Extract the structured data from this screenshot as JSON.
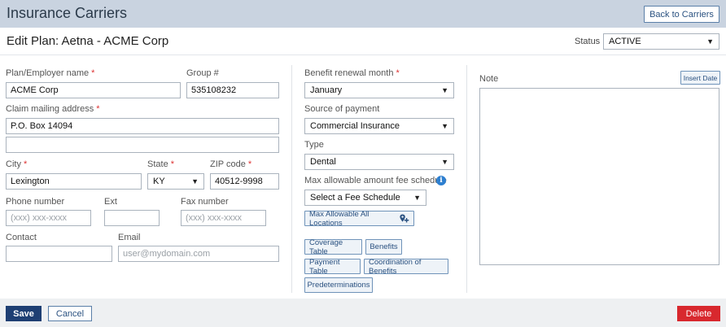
{
  "header": {
    "title": "Insurance Carriers",
    "back_button": "Back to Carriers"
  },
  "subheader": {
    "title": "Edit Plan: Aetna - ACME Corp",
    "status_label": "Status",
    "status_value": "ACTIVE"
  },
  "form": {
    "plan_name_label": "Plan/Employer name",
    "plan_name_value": "ACME Corp",
    "group_label": "Group #",
    "group_value": "535108232",
    "claim_address_label": "Claim mailing address",
    "claim_address_line1": "P.O. Box 14094",
    "claim_address_line2": "",
    "city_label": "City",
    "city_value": "Lexington",
    "state_label": "State",
    "state_value": "KY",
    "zip_label": "ZIP code",
    "zip_value": "40512-9998",
    "phone_label": "Phone number",
    "phone_placeholder": "(xxx) xxx-xxxx",
    "ext_label": "Ext",
    "fax_label": "Fax number",
    "fax_placeholder": "(xxx) xxx-xxxx",
    "contact_label": "Contact",
    "email_label": "Email",
    "email_placeholder": "user@mydomain.com",
    "required_marker": "*"
  },
  "benefits": {
    "renewal_label": "Benefit renewal month",
    "renewal_value": "January",
    "payment_source_label": "Source of payment",
    "payment_source_value": "Commercial Insurance",
    "type_label": "Type",
    "type_value": "Dental",
    "fee_schedule_label": "Max allowable amount fee schedule",
    "fee_schedule_value": "Select a Fee Schedule",
    "max_allowable_button": "Max Allowable All Locations",
    "buttons": {
      "coverage_table": "Coverage Table",
      "benefits": "Benefits",
      "payment_table": "Payment Table",
      "coordination": "Coordination of Benefits",
      "predeterminations": "Predeterminations"
    }
  },
  "note": {
    "label": "Note",
    "insert_date": "Insert Date"
  },
  "footer": {
    "save": "Save",
    "cancel": "Cancel",
    "delete": "Delete"
  },
  "icons": {
    "chevron": "chevron-down-icon",
    "info": "info-icon",
    "location_add": "location-pin-plus-icon"
  },
  "colors": {
    "header_bg": "#c9d3e0",
    "primary": "#1e3f73",
    "danger": "#d8282e",
    "link": "#2a5180",
    "required": "#dd3333",
    "info": "#2d7fd0"
  }
}
